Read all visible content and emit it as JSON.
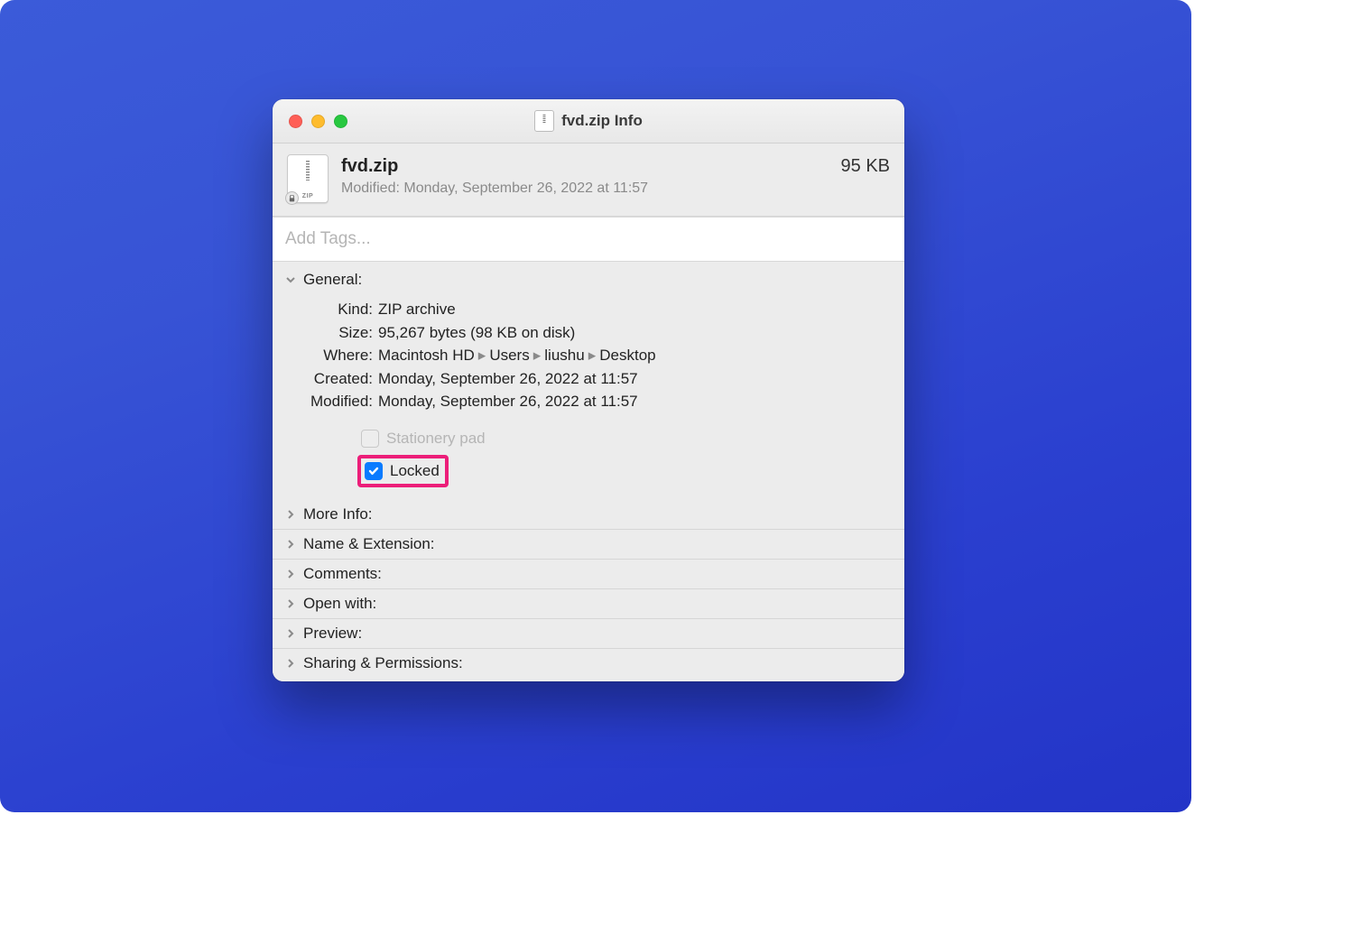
{
  "window": {
    "title": "fvd.zip Info"
  },
  "header": {
    "filename": "fvd.zip",
    "modified_line": "Modified: Monday, September 26, 2022 at 11:57",
    "size": "95 KB"
  },
  "tags": {
    "placeholder": "Add Tags..."
  },
  "general": {
    "title": "General:",
    "kind_label": "Kind:",
    "kind_value": "ZIP archive",
    "size_label": "Size:",
    "size_value": "95,267 bytes (98 KB on disk)",
    "where_label": "Where:",
    "where_parts": [
      "Macintosh HD",
      "Users",
      "liushu",
      "Desktop"
    ],
    "created_label": "Created:",
    "created_value": "Monday, September 26, 2022 at 11:57",
    "modified_label": "Modified:",
    "modified_value": "Monday, September 26, 2022 at 11:57",
    "stationery_label": "Stationery pad",
    "stationery_checked": false,
    "stationery_enabled": false,
    "locked_label": "Locked",
    "locked_checked": true
  },
  "sections": {
    "more_info": "More Info:",
    "name_ext": "Name & Extension:",
    "comments": "Comments:",
    "open_with": "Open with:",
    "preview": "Preview:",
    "sharing": "Sharing & Permissions:"
  }
}
